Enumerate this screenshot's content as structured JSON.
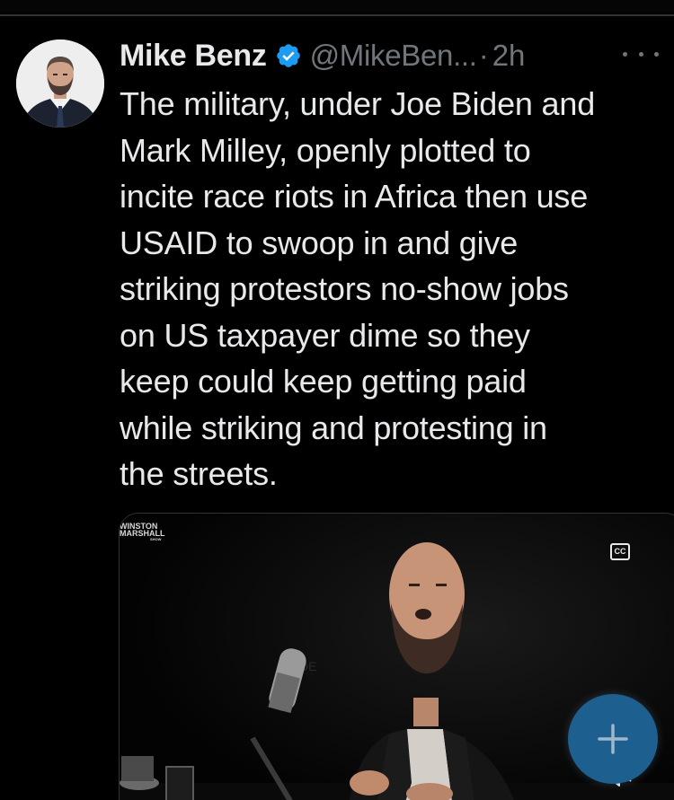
{
  "tweet": {
    "author": {
      "display_name": "Mike Benz",
      "handle": "@MikeBen...",
      "verified": true
    },
    "separator": "·",
    "time": "2h",
    "text": "The military, under Joe Biden and\nMark Milley, openly plotted to\nincite race riots in Africa then use\nUSAID to swoop in and give\nstriking protestors no-show jobs\non US taxpayer dime so they\nkeep could keep getting paid\nwhile striking and protesting in\nthe streets.",
    "media": {
      "type": "video",
      "watermark_line1": "WINSTON",
      "watermark_line2": "MARSHALL",
      "watermark_line3": "SHOW",
      "captions_label": "CC",
      "muted": true
    }
  },
  "icons": {
    "verified": "verified-badge-icon",
    "more": "more-horizontal-icon",
    "captions": "closed-captions-icon",
    "mute": "speaker-muted-icon",
    "compose": "plus-icon"
  },
  "colors": {
    "background": "#000000",
    "text_primary": "#e7e9ea",
    "text_secondary": "#71767b",
    "verified_blue": "#1d9bf0",
    "fab": "#1d5f8f",
    "divider": "#2f3336"
  }
}
